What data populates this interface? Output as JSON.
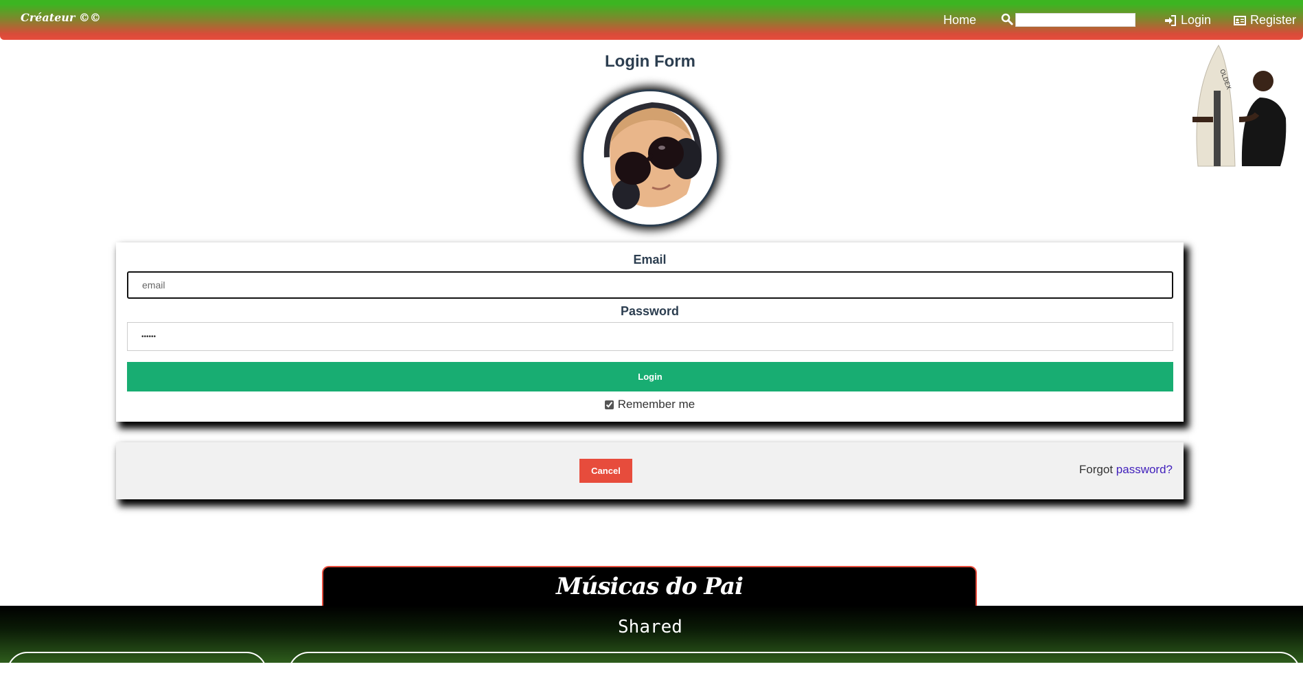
{
  "navbar": {
    "brand": "Créateur ©©",
    "home_label": "Home",
    "search_placeholder": "",
    "login_label": "Login",
    "register_label": "Register"
  },
  "login": {
    "title": "Login Form",
    "email_label": "Email",
    "email_placeholder": "email",
    "email_value": "",
    "password_label": "Password",
    "password_value": "••••••",
    "submit_label": "Login",
    "remember_label": "Remember me",
    "remember_checked": true
  },
  "actions": {
    "cancel_label": "Cancel",
    "forgot_prefix": "Forgot",
    "forgot_link": "password?"
  },
  "music": {
    "banner_title": "Músicas do Pai",
    "section_title": "Shared"
  },
  "colors": {
    "nav_top": "#3cb521",
    "nav_bottom": "#e74c3c",
    "login_button": "#18ad72",
    "cancel_button": "#e74c3c",
    "link": "#3f1ebb",
    "title": "#2c3e50"
  },
  "icons": {
    "search": "search-icon",
    "login": "sign-in-icon",
    "register": "id-card-icon"
  }
}
